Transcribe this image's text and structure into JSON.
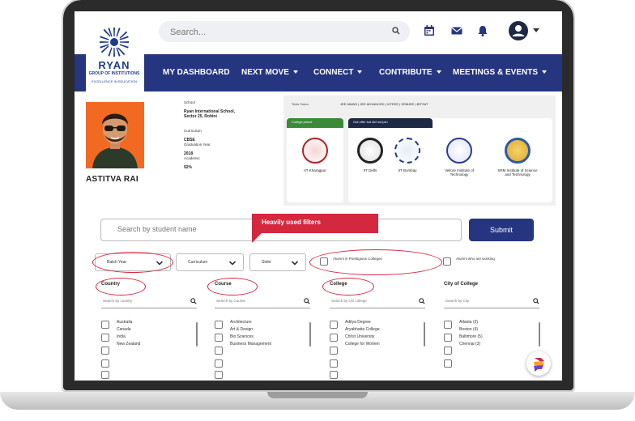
{
  "search": {
    "placeholder": "Search..."
  },
  "logo": {
    "name": "RYAN",
    "sub": "GROUP OF INSTITUTIONS",
    "tagline": "EXCELLENCE IN EDUCATION"
  },
  "nav": [
    {
      "label": "MY DASHBOARD",
      "dropdown": false
    },
    {
      "label": "NEXT MOVE",
      "dropdown": true
    },
    {
      "label": "CONNECT",
      "dropdown": true
    },
    {
      "label": "CONTRIBUTE",
      "dropdown": true
    },
    {
      "label": "MEETINGS & EVENTS",
      "dropdown": true
    }
  ],
  "profile": {
    "name": "ASTITVA RAI",
    "school_label": "School",
    "school": "Ryan International School, Sector 25, Rohini",
    "curriculum_label": "Curriculum",
    "curriculum": "CBSE",
    "grad_label": "Graduation Year",
    "grad": "2018",
    "academic_label": "Academic",
    "academic": "92%"
  },
  "tests": {
    "label": "Tests Taken",
    "value": "JEE MAINS | JEE ADVANCED | VITEEE | SRMJEE | BITSAT"
  },
  "college_joined": {
    "tag": "College joined",
    "colleges": [
      {
        "name": "IIT Kharagpur",
        "seal": "#b22222"
      }
    ]
  },
  "offers": {
    "tag": "Got offer but did not join",
    "colleges": [
      {
        "name": "IIT Delhi",
        "seal": "#222222"
      },
      {
        "name": "IIT Bombay",
        "seal": "#1f3c8c"
      },
      {
        "name": "Vellore Institute of Technology",
        "seal": "#2a3c8f"
      },
      {
        "name": "SRM Institute of Science and Technology",
        "seal": "#2a5aa8"
      }
    ]
  },
  "student_search": {
    "placeholder": "Search by student name"
  },
  "submit_label": "Submit",
  "bubble": "Heavily used filters",
  "dropdowns": [
    {
      "label": "Batch Year"
    },
    {
      "label": "Curriculum"
    },
    {
      "label": "Stdnt"
    }
  ],
  "checkboxes": [
    {
      "label": "Alumni in Prestigious Colleges"
    },
    {
      "label": "Alumni who are working"
    }
  ],
  "columns": [
    {
      "title": "Country",
      "placeholder": "Search by country",
      "options": [
        "Australia",
        "Canada",
        "India",
        "New Zealand",
        ""
      ]
    },
    {
      "title": "Course",
      "placeholder": "Search by Course",
      "options": [
        "Architecture",
        "Art & Design",
        "Bio Sciences",
        "Business Management",
        ""
      ]
    },
    {
      "title": "College",
      "placeholder": "Search by UG college",
      "options": [
        "Aditya Degree",
        "Aryabhatta College",
        "Christ University",
        "College for Women",
        ""
      ]
    },
    {
      "title": "City of College",
      "placeholder": "Search by City",
      "options": [
        "Atlanta (3)",
        "Boston (4)",
        "Baltimore (5)",
        "Chennai (3)"
      ]
    }
  ],
  "colors": {
    "navy": "#26357f",
    "accent": "#d4283f",
    "orange": "#f26a22",
    "green": "#3a8a3a",
    "darknavy": "#1e2a44"
  }
}
